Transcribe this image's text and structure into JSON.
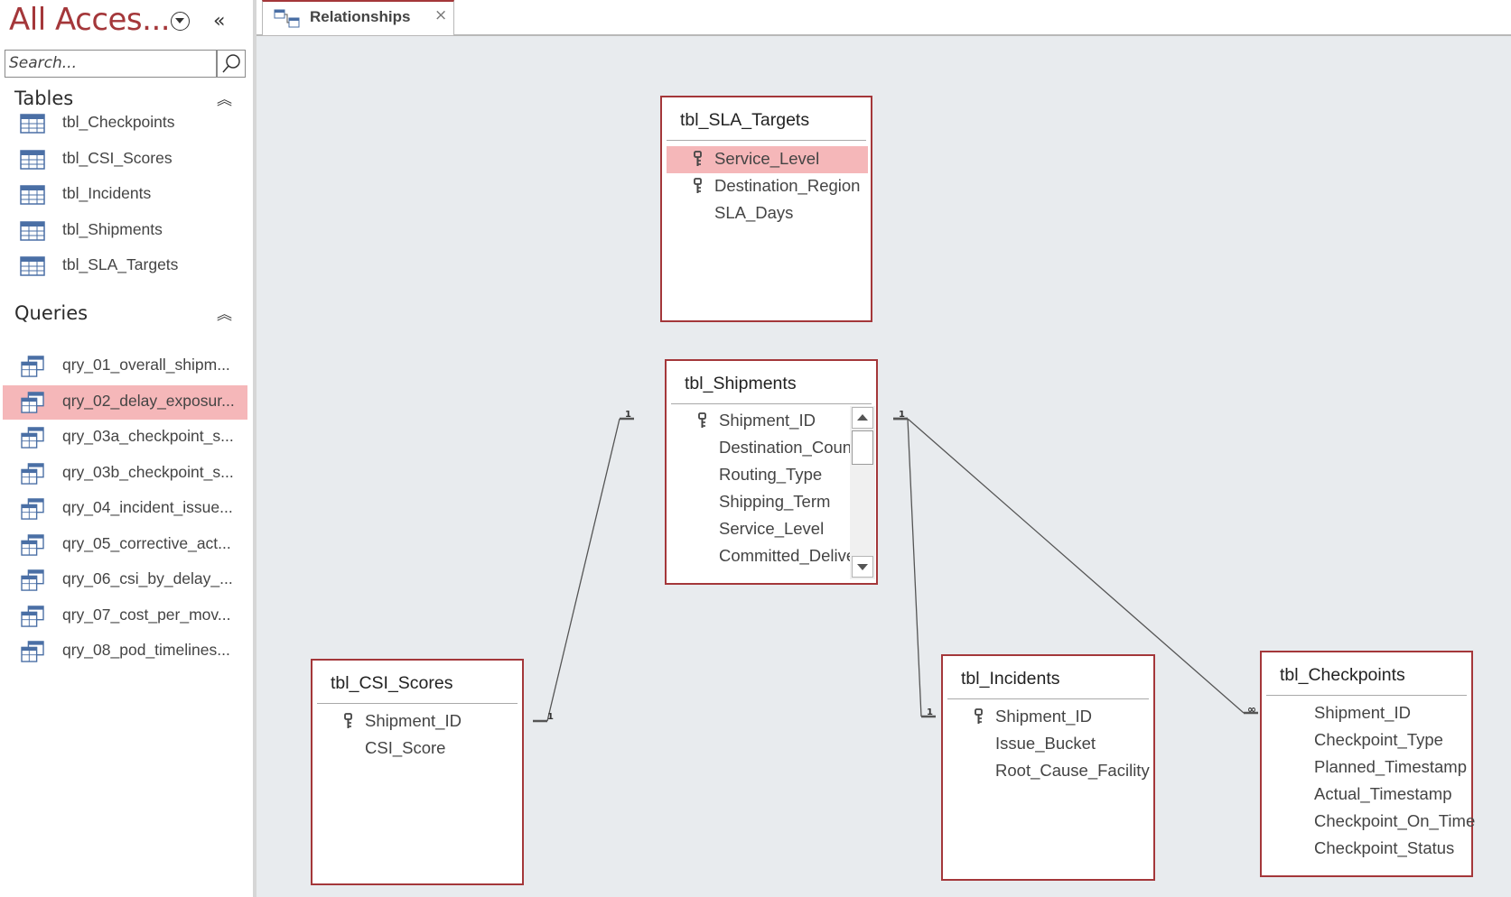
{
  "nav": {
    "title": "All Acces...",
    "search_placeholder": "Search...",
    "tables_heading": "Tables",
    "queries_heading": "Queries",
    "tables": [
      {
        "label": "tbl_Checkpoints"
      },
      {
        "label": "tbl_CSI_Scores"
      },
      {
        "label": "tbl_Incidents"
      },
      {
        "label": "tbl_Shipments"
      },
      {
        "label": "tbl_SLA_Targets"
      }
    ],
    "queries": [
      {
        "label": "qry_01_overall_shipm..."
      },
      {
        "label": "qry_02_delay_exposur...",
        "selected": true
      },
      {
        "label": "qry_03a_checkpoint_s..."
      },
      {
        "label": "qry_03b_checkpoint_s..."
      },
      {
        "label": "qry_04_incident_issue..."
      },
      {
        "label": "qry_05_corrective_act..."
      },
      {
        "label": "qry_06_csi_by_delay_..."
      },
      {
        "label": "qry_07_cost_per_mov..."
      },
      {
        "label": "qry_08_pod_timelines..."
      }
    ]
  },
  "tab": {
    "label": "Relationships",
    "close": "×"
  },
  "tables": {
    "sla_targets": {
      "title": "tbl_SLA_Targets",
      "fields": [
        {
          "name": "Service_Level",
          "key": true,
          "selected": true
        },
        {
          "name": "Destination_Region",
          "key": true
        },
        {
          "name": "SLA_Days",
          "key": false
        }
      ]
    },
    "shipments": {
      "title": "tbl_Shipments",
      "fields": [
        {
          "name": "Shipment_ID",
          "key": true
        },
        {
          "name": "Destination_Count",
          "key": false
        },
        {
          "name": "Routing_Type",
          "key": false
        },
        {
          "name": "Shipping_Term",
          "key": false
        },
        {
          "name": "Service_Level",
          "key": false
        },
        {
          "name": "Committed_Deliver",
          "key": false
        }
      ]
    },
    "csi_scores": {
      "title": "tbl_CSI_Scores",
      "fields": [
        {
          "name": "Shipment_ID",
          "key": true
        },
        {
          "name": "CSI_Score",
          "key": false
        }
      ]
    },
    "incidents": {
      "title": "tbl_Incidents",
      "fields": [
        {
          "name": "Shipment_ID",
          "key": true
        },
        {
          "name": "Issue_Bucket",
          "key": false
        },
        {
          "name": "Root_Cause_Facility",
          "key": false
        }
      ]
    },
    "checkpoints": {
      "title": "tbl_Checkpoints",
      "fields": [
        {
          "name": "Shipment_ID",
          "key": false
        },
        {
          "name": "Checkpoint_Type",
          "key": false
        },
        {
          "name": "Planned_Timestamp",
          "key": false
        },
        {
          "name": "Actual_Timestamp",
          "key": false
        },
        {
          "name": "Checkpoint_On_Time",
          "key": false
        },
        {
          "name": "Checkpoint_Status",
          "key": false
        }
      ]
    }
  },
  "relationships": [
    {
      "from": "tbl_Shipments.Shipment_ID",
      "to": "tbl_CSI_Scores.Shipment_ID",
      "from_card": "1",
      "to_card": "1"
    },
    {
      "from": "tbl_Shipments.Shipment_ID",
      "to": "tbl_Incidents.Shipment_ID",
      "from_card": "1",
      "to_card": "1"
    },
    {
      "from": "tbl_Shipments.Shipment_ID",
      "to": "tbl_Checkpoints.Shipment_ID",
      "from_card": "1",
      "to_card": "∞"
    }
  ],
  "colors": {
    "accent": "#a4373a",
    "selection": "#f5b7b9",
    "canvas": "#e8ebee"
  }
}
